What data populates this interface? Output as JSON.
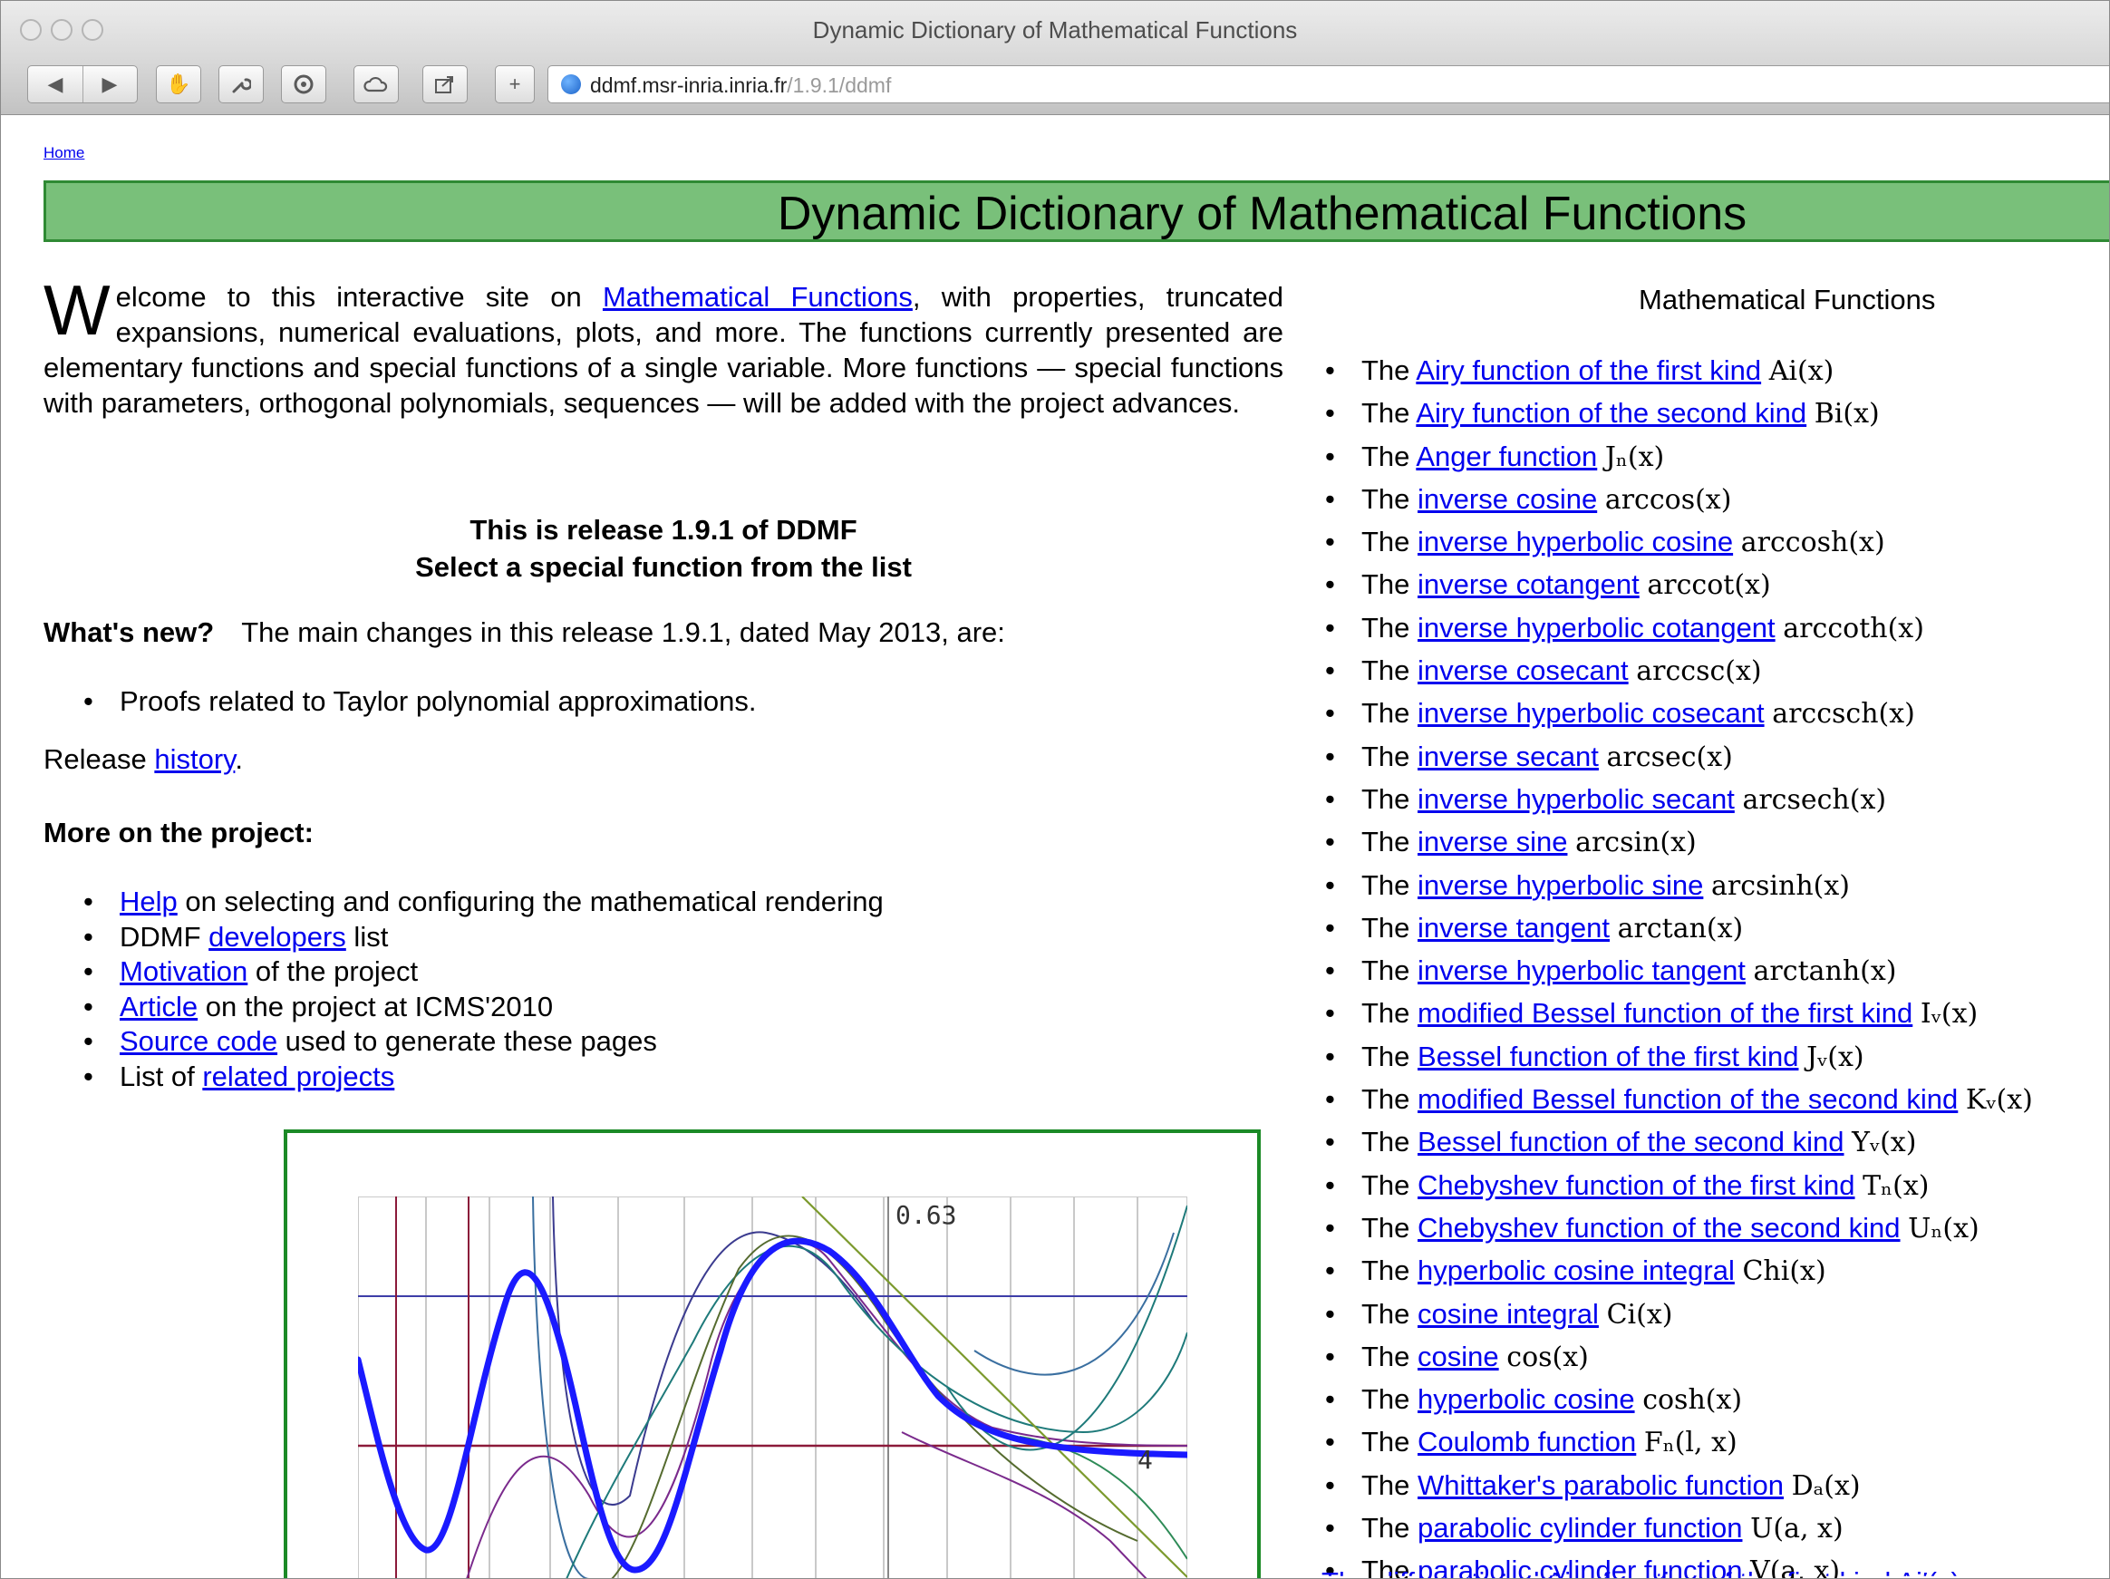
{
  "window": {
    "title": "Dynamic Dictionary of Mathematical Functions"
  },
  "toolbar": {
    "back_icon": "back-arrow-icon",
    "forward_icon": "forward-arrow-icon",
    "url_domain": "ddmf.msr-inria.inria.fr",
    "url_path": "/1.9.1/ddmf"
  },
  "page": {
    "home_link": "Home",
    "banner_title": "Dynamic Dictionary of Mathematical Functions",
    "intro": {
      "dropcap": "W",
      "before_link": "elcome to this interactive site on ",
      "link": "Mathematical Functions",
      "after_link": ", with properties, truncated expansions, numerical evaluations, plots, and more. The functions currently presented are elementary functions and special functions of a single variable. More functions — special functions with parameters, orthogonal polynomials, sequences — will be added with the project advances."
    },
    "release_line1": "This is release 1.9.1 of DDMF",
    "release_line2": "Select a special function from the list",
    "whatsnew_label": "What's new?",
    "whatsnew_text": "The main changes in this release 1.9.1, dated May 2013, are:",
    "whatsnew_items": [
      "Proofs related to Taylor polynomial approximations."
    ],
    "release_history_prefix": "Release ",
    "release_history_link": "history",
    "release_history_suffix": ".",
    "more_title": "More on the project:",
    "project_items": [
      {
        "pre": "",
        "link": "Help",
        "post": " on selecting and configuring the mathematical rendering"
      },
      {
        "pre": "DDMF ",
        "link": "developers",
        "post": " list"
      },
      {
        "pre": "",
        "link": "Motivation",
        "post": " of the project"
      },
      {
        "pre": "",
        "link": "Article",
        "post": " on the project at ICMS'2010"
      },
      {
        "pre": "",
        "link": "Source code",
        "post": " used to generate these pages"
      },
      {
        "pre": "List of ",
        "link": "related projects",
        "post": ""
      }
    ],
    "plot": {
      "label_top": "0.63",
      "label_right": "4"
    }
  },
  "functions_title": "Mathematical Functions",
  "functions": [
    {
      "link": "Airy function of the first kind",
      "math": "Ai(x)"
    },
    {
      "link": "Airy function of the second kind",
      "math": "Bi(x)"
    },
    {
      "link": "Anger function",
      "math": "Jₙ(x)"
    },
    {
      "link": "inverse cosine",
      "math": "arccos(x)"
    },
    {
      "link": "inverse hyperbolic cosine",
      "math": "arccosh(x)"
    },
    {
      "link": "inverse cotangent",
      "math": "arccot(x)"
    },
    {
      "link": "inverse hyperbolic cotangent",
      "math": "arccoth(x)"
    },
    {
      "link": "inverse cosecant",
      "math": "arccsc(x)"
    },
    {
      "link": "inverse hyperbolic cosecant",
      "math": "arccsch(x)"
    },
    {
      "link": "inverse secant",
      "math": "arcsec(x)"
    },
    {
      "link": "inverse hyperbolic secant",
      "math": "arcsech(x)"
    },
    {
      "link": "inverse sine",
      "math": "arcsin(x)"
    },
    {
      "link": "inverse hyperbolic sine",
      "math": "arcsinh(x)"
    },
    {
      "link": "inverse tangent",
      "math": "arctan(x)"
    },
    {
      "link": "inverse hyperbolic tangent",
      "math": "arctanh(x)"
    },
    {
      "link": "modified Bessel function of the first kind",
      "math": "Iᵥ(x)"
    },
    {
      "link": "Bessel function of the first kind",
      "math": "Jᵥ(x)"
    },
    {
      "link": "modified Bessel function of the second kind",
      "math": "Kᵥ(x)"
    },
    {
      "link": "Bessel function of the second kind",
      "math": "Yᵥ(x)"
    },
    {
      "link": "Chebyshev function of the first kind",
      "math": "Tₙ(x)"
    },
    {
      "link": "Chebyshev function of the second kind",
      "math": "Uₙ(x)"
    },
    {
      "link": "hyperbolic cosine integral",
      "math": "Chi(x)"
    },
    {
      "link": "cosine integral",
      "math": "Ci(x)"
    },
    {
      "link": "cosine",
      "math": "cos(x)"
    },
    {
      "link": "hyperbolic cosine",
      "math": "cosh(x)"
    },
    {
      "link": "Coulomb function",
      "math": "Fₙ(l, x)"
    },
    {
      "link": "Whittaker's parabolic function",
      "math": "Dₐ(x)"
    },
    {
      "link": "parabolic cylinder function",
      "math": "U(a, x)"
    },
    {
      "link": "parabolic cylinder function",
      "math": "V(a, x)"
    }
  ],
  "functions_prefix": "The ",
  "functions_cut_off": "The differentiated Airy function of the first kind Ai′(x)"
}
